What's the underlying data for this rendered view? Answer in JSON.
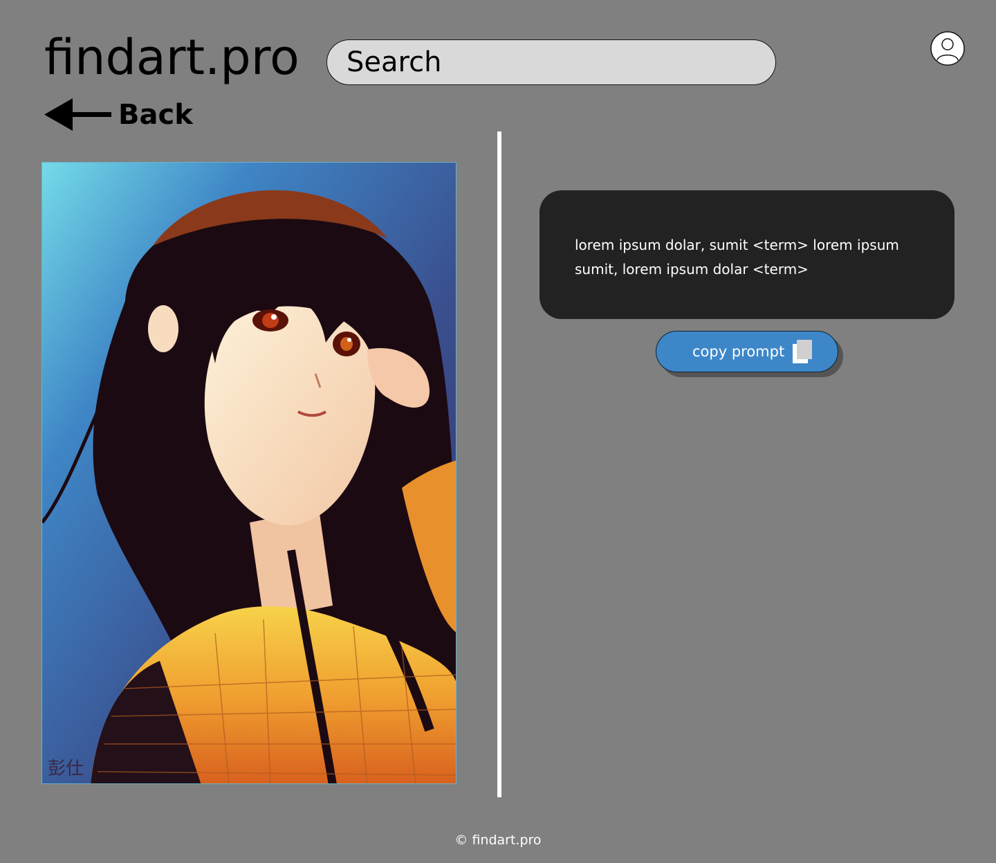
{
  "header": {
    "logo": "findart.pro",
    "search_placeholder": "Search",
    "avatar_icon": "user-avatar-icon"
  },
  "nav": {
    "back_label": "Back",
    "back_icon": "arrow-left-icon"
  },
  "artwork": {
    "alt": "anime artwork",
    "signature": "彭仕"
  },
  "prompt": {
    "text": "lorem ipsum dolar, sumit <term> lorem ipsum sumit, lorem ipsum dolar <term>",
    "copy_label": "copy prompt",
    "copy_icon": "copy-icon"
  },
  "footer": {
    "copyright": "© findart.pro"
  },
  "colors": {
    "background": "#808080",
    "search_fill": "#d9d9d9",
    "prompt_box": "#222222",
    "copy_button": "#3d87c9",
    "divider": "#ffffff"
  }
}
